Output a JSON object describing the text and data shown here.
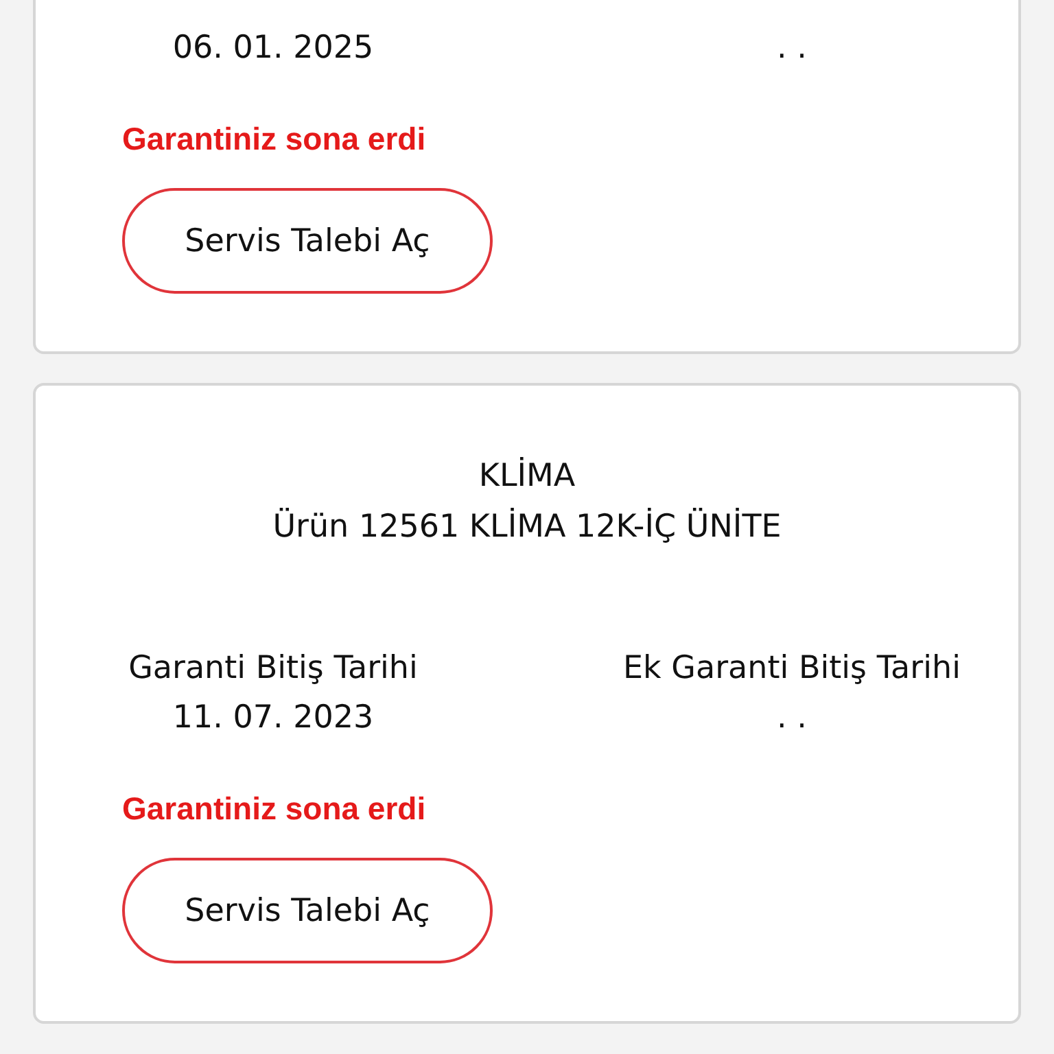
{
  "cards": [
    {
      "warranty_date": "06. 01. 2025",
      "extra_date": ". .",
      "status": "Garantiniz sona erdi",
      "button": "Servis Talebi Aç"
    },
    {
      "category": "KLİMA",
      "product": "Ürün 12561 KLİMA 12K-İÇ ÜNİTE",
      "warranty_label": "Garanti Bitiş Tarihi",
      "warranty_date": "11. 07. 2023",
      "extra_label": "Ek Garanti Bitiş Tarihi",
      "extra_date": ". .",
      "status": "Garantiniz sona erdi",
      "button": "Servis Talebi Aç"
    }
  ]
}
